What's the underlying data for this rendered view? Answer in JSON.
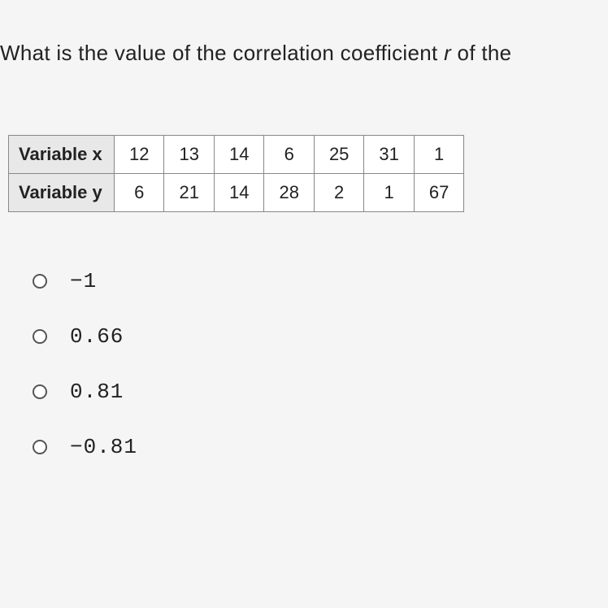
{
  "question": {
    "prefix": "What is the value of the correlation coefficient ",
    "italic": "r",
    "suffix": " of the"
  },
  "table": {
    "rows": [
      {
        "header": "Variable x",
        "cells": [
          "12",
          "13",
          "14",
          "6",
          "25",
          "31",
          "1"
        ]
      },
      {
        "header": "Variable y",
        "cells": [
          "6",
          "21",
          "14",
          "28",
          "2",
          "1",
          "67"
        ]
      }
    ]
  },
  "options": [
    {
      "label": "−1"
    },
    {
      "label": "0.66"
    },
    {
      "label": "0.81"
    },
    {
      "label": "−0.81"
    }
  ]
}
